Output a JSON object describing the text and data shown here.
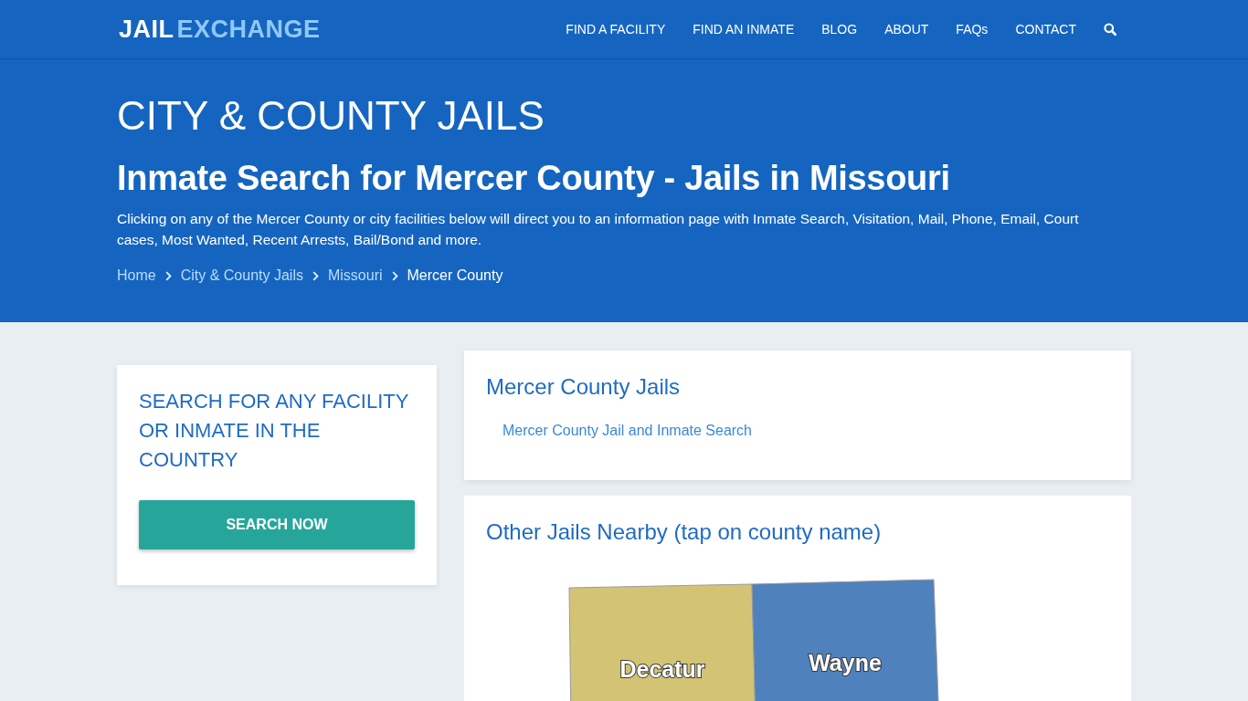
{
  "header": {
    "logo": {
      "part_1": "JAIL",
      "part_2": "EXCHANGE"
    },
    "nav": [
      "FIND A FACILITY",
      "FIND AN INMATE",
      "BLOG",
      "ABOUT",
      "FAQs",
      "CONTACT"
    ]
  },
  "hero": {
    "title": "CITY & COUNTY JAILS",
    "subtitle": "Inmate Search for Mercer County - Jails in Missouri",
    "description": "Clicking on any of the Mercer County or city facilities below will direct you to an information page with Inmate Search, Visitation, Mail, Phone, Email, Court cases, Most Wanted, Recent Arrests, Bail/Bond and more.",
    "breadcrumb": [
      {
        "label": "Home",
        "current": false
      },
      {
        "label": "City & County Jails",
        "current": false
      },
      {
        "label": "Missouri",
        "current": false
      },
      {
        "label": "Mercer County",
        "current": true
      }
    ]
  },
  "sidebar": {
    "title": "SEARCH FOR ANY FACILITY OR INMATE IN THE COUNTRY",
    "button": "SEARCH NOW"
  },
  "facilities": {
    "title": "Mercer County Jails",
    "links": [
      "Mercer County Jail and Inmate Search"
    ]
  },
  "nearby": {
    "title": "Other Jails Nearby (tap on county name)",
    "counties": [
      {
        "name": "Decatur",
        "color": "#d2c474"
      },
      {
        "name": "Wayne",
        "color": "#4f81bd"
      }
    ]
  }
}
